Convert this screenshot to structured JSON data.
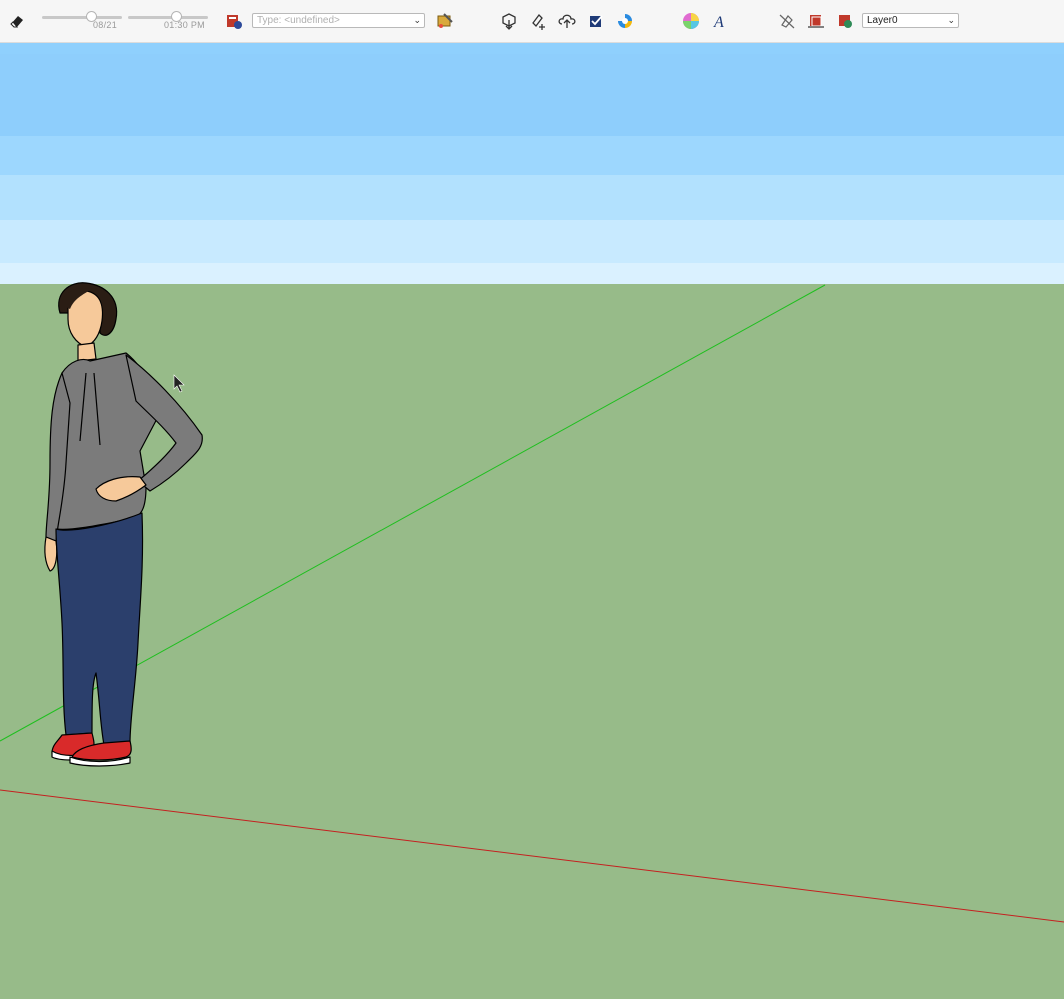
{
  "toolbar": {
    "date_label": "08/21",
    "time_label": "01:30 PM",
    "type_select": {
      "placeholder": "Type: <undefined>"
    },
    "layer_select": {
      "value": "Layer0"
    },
    "icons": [
      "eraser-icon",
      "shadow-date-slider",
      "shadow-time-slider",
      "classifier-icon",
      "type-select",
      "classify-paint-icon",
      "import-3d-icon",
      "add-location-icon",
      "upload-cloud-icon",
      "checkbox-icon",
      "extension-icon",
      "color-wheel-icon",
      "text-style-icon",
      "untitled-tool-icon",
      "section-icon",
      "display-section-icon",
      "layer-select"
    ]
  },
  "scene": {
    "sky_colors": [
      "#8fd0fd",
      "#8ecefc",
      "#9dd7fe",
      "#b2e1fe",
      "#c8eaff",
      "#daf1ff"
    ],
    "ground_color": "#97bb89",
    "green_axis_color": "#1fbf1f",
    "red_axis_color": "#c42020",
    "figure": "person-figure"
  }
}
